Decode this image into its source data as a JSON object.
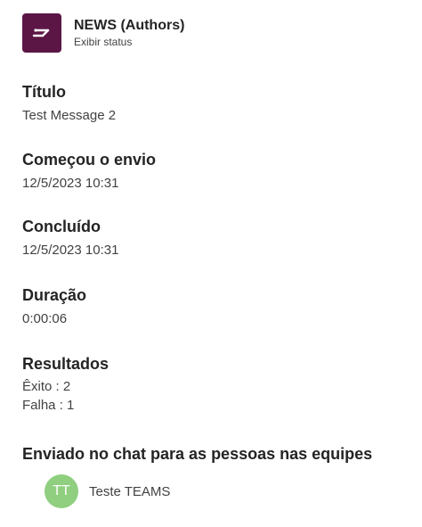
{
  "header": {
    "app_name": "NEWS (Authors)",
    "status_link": "Exibir status",
    "icon": "app-logo-icon",
    "icon_color": "#5b1646"
  },
  "sections": {
    "title": {
      "label": "Título",
      "value": "Test Message 2"
    },
    "started": {
      "label": "Começou o envio",
      "value": "12/5/2023 10:31"
    },
    "completed": {
      "label": "Concluído",
      "value": "12/5/2023 10:31"
    },
    "duration": {
      "label": "Duração",
      "value": "0:00:06"
    },
    "results": {
      "label": "Resultados",
      "success": "Êxito : 2",
      "failure": "Falha : 1"
    },
    "sent_to": {
      "label": "Enviado no chat para as pessoas nas equipes",
      "recipients": [
        {
          "initials": "TT",
          "name": "Teste TEAMS",
          "avatar_color": "#8fcf7f"
        }
      ]
    }
  }
}
